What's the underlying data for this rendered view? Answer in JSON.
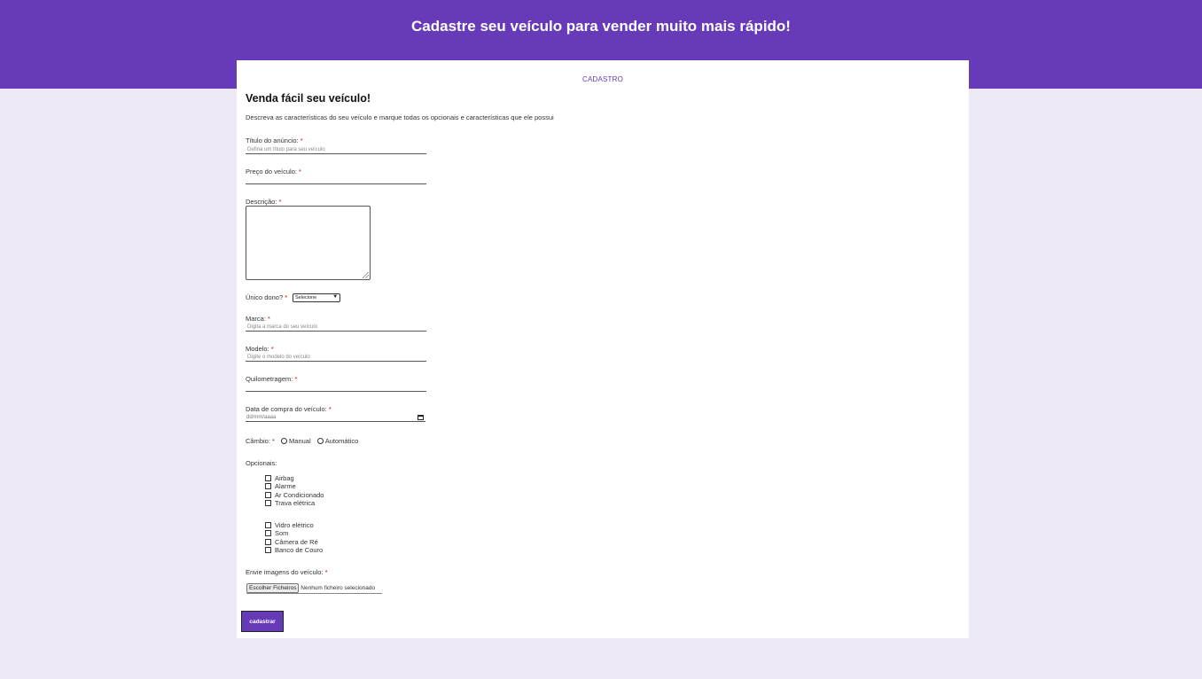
{
  "header": {
    "title": "Cadastre seu veículo para vender muito mais rápido!"
  },
  "card": {
    "tab_label": "CADASTRO",
    "heading": "Venda fácil seu veículo!",
    "description": "Descreva as características do seu veículo e marque todas os opcionais e características que ele possui"
  },
  "form": {
    "required_mark": "*",
    "titulo": {
      "label": "Título do anúncio:",
      "placeholder": "Defina um título para seu veículo"
    },
    "preco": {
      "label": "Preço do veículo:",
      "placeholder": ""
    },
    "descricao": {
      "label": "Descrição:"
    },
    "unico_dono": {
      "label": "Único dono?",
      "selected": "Selecione"
    },
    "marca": {
      "label": "Marca:",
      "placeholder": "Digita a marca do seu veículo"
    },
    "modelo": {
      "label": "Modelo:",
      "placeholder": "Digite o modelo do veículo"
    },
    "quilometragem": {
      "label": "Quilometragem:",
      "placeholder": ""
    },
    "data_compra": {
      "label": "Data de compra do veículo:",
      "placeholder": "dd/mm/aaaa"
    },
    "cambio": {
      "label": "Câmbio:",
      "options": [
        "Manual",
        "Automático"
      ]
    },
    "opcionais": {
      "label": "Opcionais:",
      "group1": [
        "Airbag",
        "Alarme",
        "Ar Condicionado",
        "Trava elétrica"
      ],
      "group2": [
        "Vidro elétrico",
        "Som",
        "Câmera de Ré",
        "Banco de Couro"
      ]
    },
    "imagens": {
      "label": "Envie imagens do veículo:",
      "button": "Escolher Ficheiros",
      "status": "Nenhum ficheiro selecionado"
    },
    "submit_label": "cadastrar"
  },
  "colors": {
    "accent": "#673ab7",
    "background": "#ede8f6",
    "required": "#dd0000"
  }
}
